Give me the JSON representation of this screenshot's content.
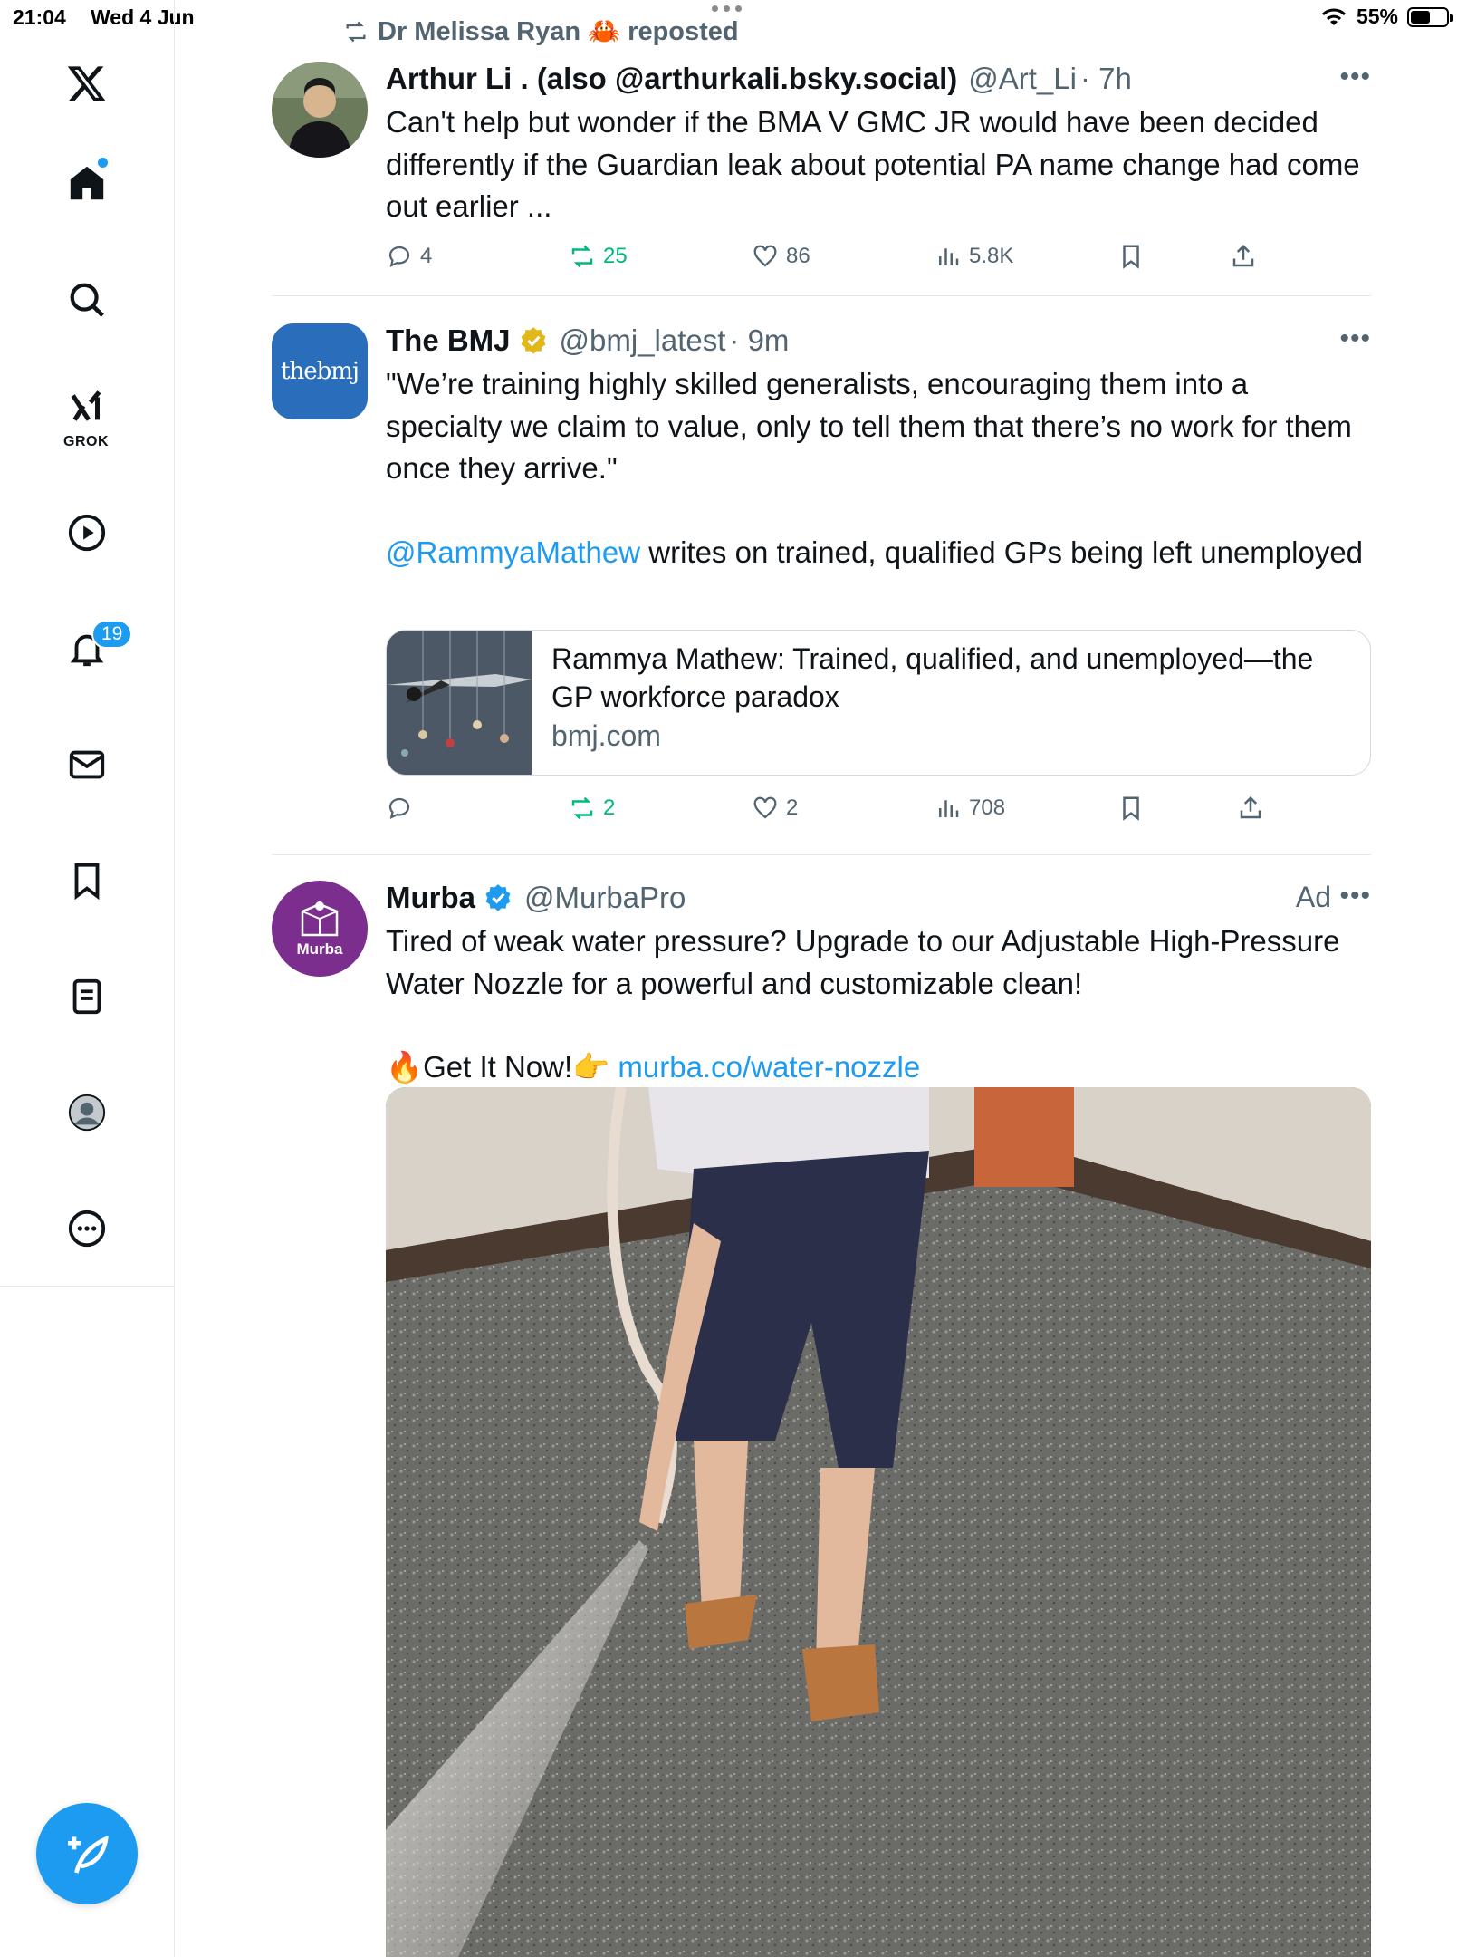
{
  "status_bar": {
    "time": "21:04",
    "date": "Wed 4 Jun",
    "battery": "55%",
    "battery_level": 0.55
  },
  "sidebar": {
    "notifications_badge": "19",
    "grok_label": "GROK",
    "items": [
      "x-logo",
      "home",
      "search",
      "grok",
      "videos",
      "notifications",
      "messages",
      "bookmarks",
      "lists",
      "profile",
      "more"
    ]
  },
  "repost": {
    "user": "Dr Melissa Ryan",
    "emoji": "🦀",
    "action": "reposted"
  },
  "tweets": [
    {
      "name": "Arthur Li . (also @arthurkali.bsky.social)",
      "handle": "@Art_Li",
      "time": "· 7h",
      "text": "Can't help but wonder if the BMA V GMC JR would have been decided differently if the Guardian leak about potential PA name change had come out earlier ...",
      "stats": {
        "replies": "4",
        "reposts": "25",
        "likes": "86",
        "views": "5.8K"
      }
    },
    {
      "name": "The BMJ",
      "handle": "@bmj_latest",
      "time": "· 9m",
      "avatar_text": "thebmj",
      "text_quote": "\"We’re training highly skilled generalists, encouraging them into a specialty we claim to value, only to tell them that there’s no work for them once they arrive.\"",
      "mention": "@RammyaMathew",
      "text_after": " writes on trained, qualified GPs being left unemployed",
      "card": {
        "title": "Rammya Mathew: Trained, qualified, and unemployed—the GP workforce paradox",
        "domain": "bmj.com"
      },
      "stats": {
        "replies": "",
        "reposts": "2",
        "likes": "2",
        "views": "708"
      }
    },
    {
      "name": "Murba",
      "handle": "@MurbaPro",
      "ad_label": "Ad",
      "avatar_text": "Murba",
      "text": "Tired of weak water pressure? Upgrade to our Adjustable High-Pressure Water Nozzle for a powerful and customizable clean!",
      "cta_emoji_1": "🔥",
      "cta": "Get It Now!",
      "cta_emoji_2": "👉",
      "link": "murba.co/water-nozzle"
    }
  ],
  "colors": {
    "accent": "#1d9bf0",
    "repost_green": "#00ba7c",
    "muted": "#536471",
    "murba_purple": "#7b2e8e",
    "bmj_blue": "#2a6ebb"
  }
}
